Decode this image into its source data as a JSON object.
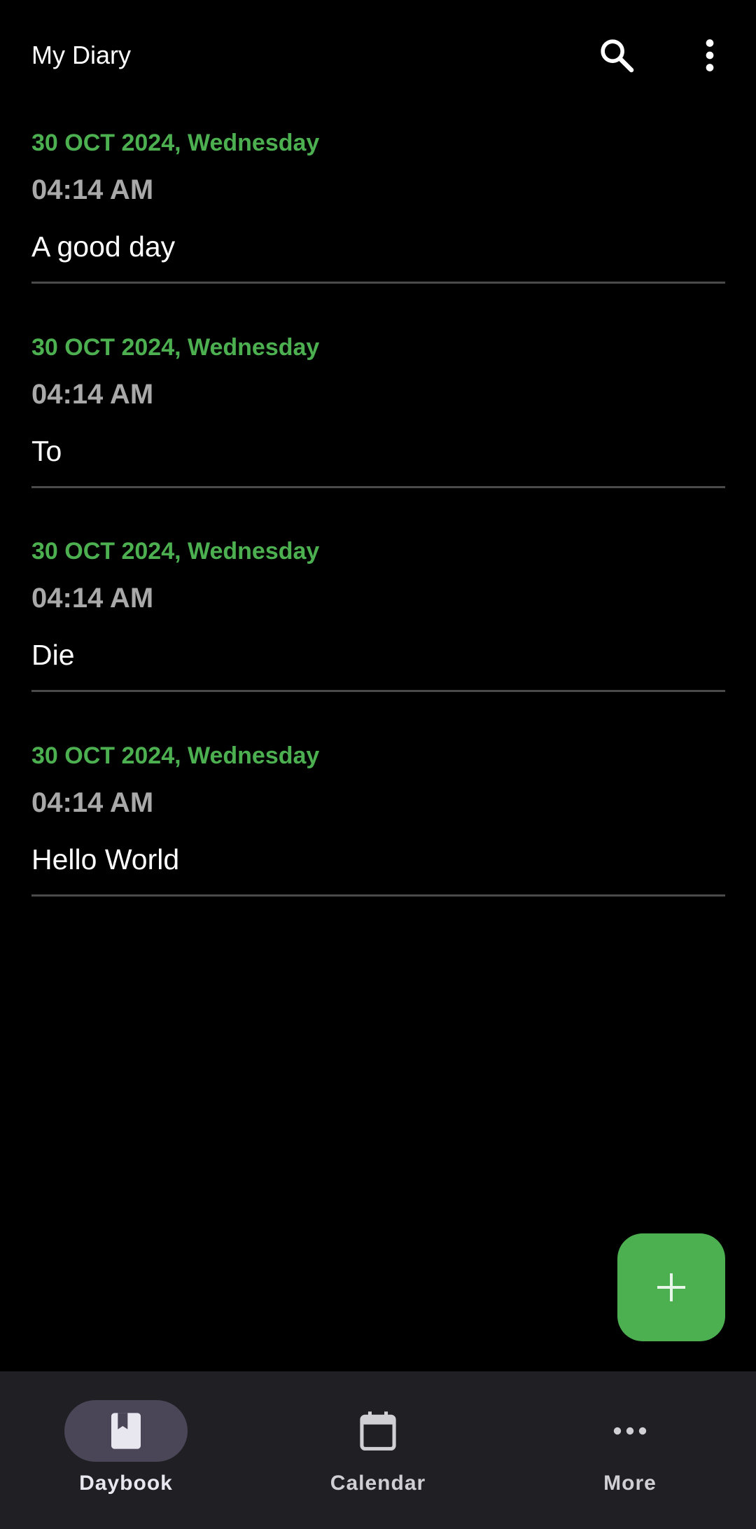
{
  "app_bar": {
    "title": "My Diary",
    "icons": [
      "search-icon",
      "more-vert-icon"
    ]
  },
  "entries": [
    {
      "date": "30 OCT 2024, Wednesday",
      "time": "04:14 AM",
      "text": "A good day"
    },
    {
      "date": "30 OCT 2024, Wednesday",
      "time": "04:14 AM",
      "text": "To"
    },
    {
      "date": "30 OCT 2024, Wednesday",
      "time": "04:14 AM",
      "text": "Die"
    },
    {
      "date": "30 OCT 2024, Wednesday",
      "time": "04:14 AM",
      "text": "Hello World"
    }
  ],
  "fab": {
    "icon": "add-icon"
  },
  "bottom_nav": {
    "selected": "Daybook",
    "items": [
      {
        "label": "Daybook",
        "icon": "book-icon"
      },
      {
        "label": "Calendar",
        "icon": "calendar-icon"
      },
      {
        "label": "More",
        "icon": "more-horiz-icon"
      }
    ]
  },
  "colors": {
    "accent": "#4caf50",
    "background": "#000000",
    "nav_background": "#202024",
    "nav_indicator": "#4a4658",
    "time_text": "#a9a9a9",
    "divider": "#4a4a4a"
  }
}
